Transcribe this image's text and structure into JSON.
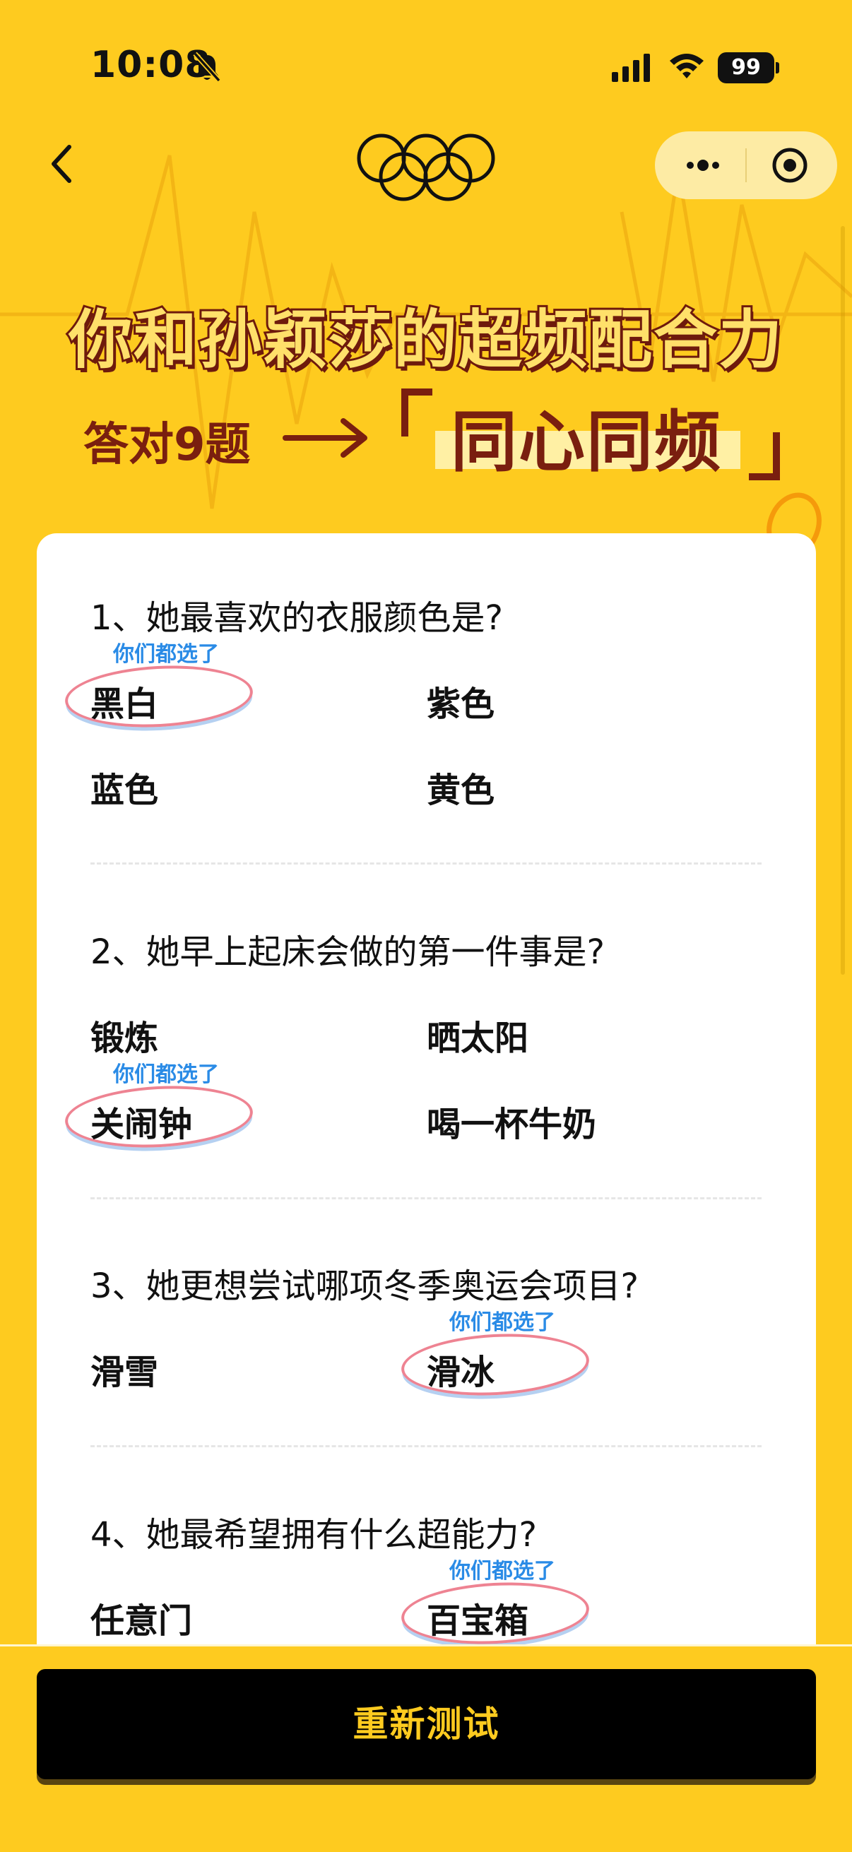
{
  "status_bar": {
    "time": "10:08",
    "battery": "99"
  },
  "hero": {
    "title": "你和孙颖莎的超频配合力",
    "subtitle": "答对9题",
    "result": "同心同频"
  },
  "questions": [
    {
      "title": "1、她最喜欢的衣服颜色是?",
      "options": [
        "黑白",
        "紫色",
        "蓝色",
        "黄色"
      ],
      "selected_tag": "你们都选了"
    },
    {
      "title": "2、她早上起床会做的第一件事是?",
      "options": [
        "锻炼",
        "晒太阳",
        "关闹钟",
        "喝一杯牛奶"
      ],
      "selected_tag": "你们都选了"
    },
    {
      "title": "3、她更想尝试哪项冬季奥运会项目?",
      "options": [
        "滑雪",
        "滑冰"
      ],
      "selected_tag": "你们都选了"
    },
    {
      "title": "4、她最希望拥有什么超能力?",
      "options": [
        "任意门",
        "百宝箱"
      ],
      "selected_tag": "你们都选了"
    }
  ],
  "footer": {
    "retest_label": "重新测试"
  },
  "colors": {
    "background": "#FECB1F",
    "title_dark": "#7A1F0F",
    "tag_blue": "#2A8BE6",
    "button": "#000000"
  }
}
